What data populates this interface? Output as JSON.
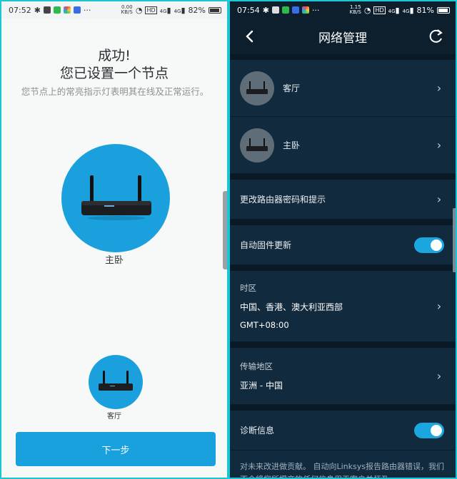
{
  "left": {
    "status": {
      "time": "07:52",
      "net_speed_top": "0.00",
      "net_speed_unit": "KB/S",
      "hd_badge": "HD",
      "signal1": "4G",
      "signal2": "4G",
      "battery": "82%"
    },
    "title_line1": "成功!",
    "title_line2": "您已设置一个节点",
    "subtitle": "您节点上的常亮指示灯表明其在线及正常运行。",
    "primary_node_label": "主卧",
    "secondary_node_label": "客厅",
    "next_button": "下一步",
    "accent": "#19a1de"
  },
  "right": {
    "status": {
      "time": "07:54",
      "net_speed_top": "1.15",
      "net_speed_unit": "KB/S",
      "hd_badge": "HD",
      "signal1": "4G",
      "signal2": "4G",
      "battery": "81%"
    },
    "title": "网络管理",
    "back_icon": "chevron-left-icon",
    "refresh_icon": "refresh-icon",
    "nodes": [
      {
        "label": "客厅"
      },
      {
        "label": "主卧"
      }
    ],
    "change_password_label": "更改路由器密码和提示",
    "auto_firmware": {
      "label": "自动固件更新",
      "enabled": true
    },
    "timezone": {
      "label": "时区",
      "value": "中国、香港、澳大利亚西部",
      "offset": "GMT+08:00"
    },
    "region": {
      "label": "传输地区",
      "value": "亚洲 - 中国"
    },
    "diagnostics": {
      "label": "诊断信息",
      "enabled": true
    },
    "diagnostics_desc": "对未来改进做贡献。 自动向Linksys报告路由器错误，我们不会将您所提交的任何信息用于客户关怀及",
    "bg": "#0e2232",
    "toggle_color": "#1ba6e0"
  }
}
